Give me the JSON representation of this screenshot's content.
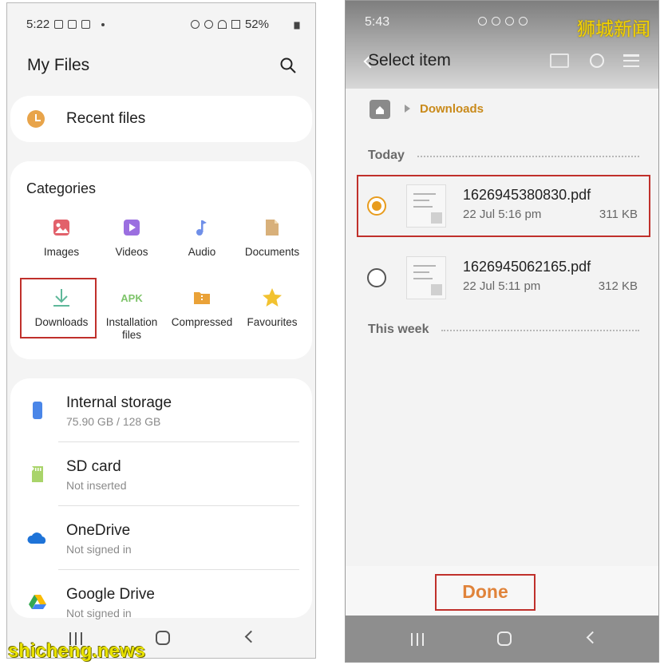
{
  "left_phone": {
    "status_bar": {
      "time": "5:22",
      "battery": "52%"
    },
    "app_title": "My Files",
    "recent": {
      "label": "Recent files"
    },
    "categories": {
      "title": "Categories",
      "items": [
        {
          "label": "Images",
          "icon": "image-icon",
          "color": "#e2616b"
        },
        {
          "label": "Videos",
          "icon": "video-icon",
          "color": "#9b6fe0"
        },
        {
          "label": "Audio",
          "icon": "music-note-icon",
          "color": "#6f8fe8"
        },
        {
          "label": "Documents",
          "icon": "document-icon",
          "color": "#d8b07a"
        },
        {
          "label": "Downloads",
          "icon": "download-icon",
          "color": "#5fb89a"
        },
        {
          "label": "Installation files",
          "icon": "apk-icon",
          "icon_text": "APK",
          "color": "#7ec46a"
        },
        {
          "label": "Compressed",
          "icon": "archive-icon",
          "color": "#eaa238"
        },
        {
          "label": "Favourites",
          "icon": "star-icon",
          "color": "#f2c230"
        }
      ]
    },
    "storage": [
      {
        "name": "Internal storage",
        "sub": "75.90 GB / 128 GB",
        "icon": "phone-storage-icon",
        "color": "#4a86e8"
      },
      {
        "name": "SD card",
        "sub": "Not inserted",
        "icon": "sd-card-icon",
        "color": "#a9d46a"
      },
      {
        "name": "OneDrive",
        "sub": "Not signed in",
        "icon": "onedrive-icon",
        "color": "#1e73d8"
      },
      {
        "name": "Google Drive",
        "sub": "Not signed in",
        "icon": "google-drive-icon",
        "color": "#34a853"
      }
    ]
  },
  "right_phone": {
    "status_bar": {
      "time": "5:43"
    },
    "header": {
      "title": "Select item"
    },
    "breadcrumb": {
      "folder": "Downloads"
    },
    "sections": {
      "today": "Today",
      "this_week": "This week"
    },
    "files": [
      {
        "name": "1626945380830.pdf",
        "date": "22 Jul 5:16 pm",
        "size": "311 KB",
        "selected": true
      },
      {
        "name": "1626945062165.pdf",
        "date": "22 Jul 5:11 pm",
        "size": "312 KB",
        "selected": false
      }
    ],
    "done_label": "Done"
  },
  "watermarks": {
    "cn": "狮城新闻",
    "en": "shicheng.news"
  },
  "colors": {
    "highlight_box": "#c0302b",
    "accent_orange": "#e89c1e"
  }
}
